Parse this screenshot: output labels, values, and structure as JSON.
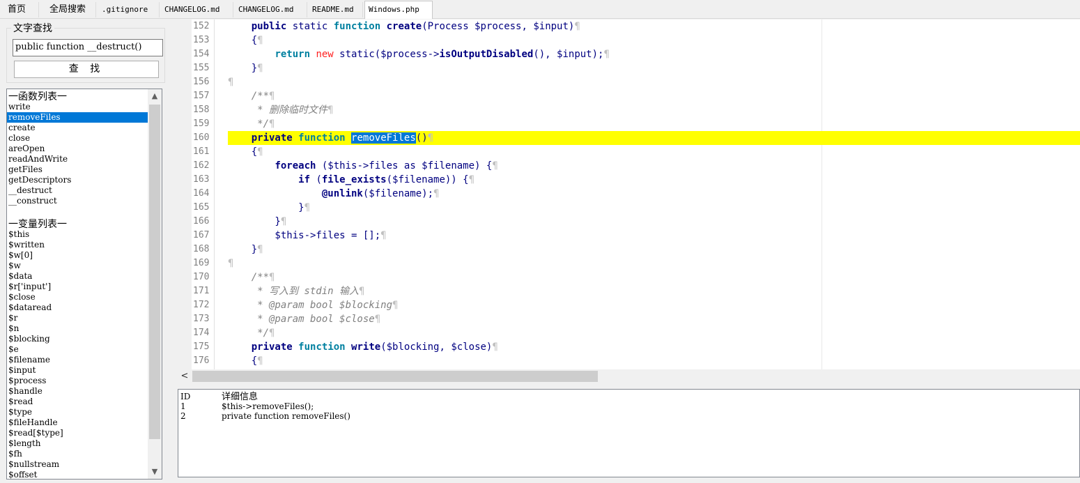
{
  "tabs": [
    "首页",
    "全局搜索",
    ".gitignore",
    "CHANGELOG.md",
    "CHANGELOG.md",
    "README.md",
    "Windows.php"
  ],
  "search": {
    "legend": "文字查找",
    "value": "public function __destruct()",
    "button_label": "查 找"
  },
  "symbols": {
    "functions_header": "一函数列表一",
    "functions": [
      "write",
      "removeFiles",
      "create",
      "close",
      "areOpen",
      "readAndWrite",
      "getFiles",
      "getDescriptors",
      "__destruct",
      "__construct"
    ],
    "selected_function": "removeFiles",
    "variables_header": "一变量列表一",
    "variables": [
      "$this",
      "$written",
      "$w[0]",
      "$w",
      "$data",
      "$r['input']",
      "$close",
      "$dataread",
      "$r",
      "$n",
      "$blocking",
      "$e",
      "$filename",
      "$input",
      "$process",
      "$handle",
      "$read",
      "$type",
      "$fileHandle",
      "$read[$type]",
      "$length",
      "$fh",
      "$nullstream",
      "$offset"
    ]
  },
  "editor": {
    "line_numbers": [
      "152",
      "153",
      "154",
      "155",
      "156",
      "157",
      "158",
      "159",
      "160",
      "161",
      "162",
      "163",
      "164",
      "165",
      "166",
      "167",
      "168",
      "169",
      "170",
      "171",
      "172",
      "173",
      "174",
      "175",
      "176"
    ],
    "highlighted_line": "160",
    "selected_word": "removeFiles",
    "code": {
      "l152": [
        "    ",
        "public",
        " static ",
        "function",
        " ",
        "create",
        "(Process $process, $input)"
      ],
      "l153": "    {",
      "l154": [
        "        ",
        "return",
        " ",
        "new",
        " static($process->",
        "isOutputDisabled",
        "(), $input);"
      ],
      "l155": "    }",
      "l156": "",
      "l157": "    /**",
      "l158": "     * 删除临时文件",
      "l159": "     */",
      "l160": [
        "    ",
        "private",
        " ",
        "function",
        " ",
        "removeFiles",
        "()"
      ],
      "l161": "    {",
      "l162": [
        "        ",
        "foreach",
        " ($this->files as $filename) {"
      ],
      "l163": [
        "            ",
        "if",
        " (",
        "file_exists",
        "($filename)) {"
      ],
      "l164": [
        "                ",
        "@unlink",
        "($filename);"
      ],
      "l165": "            }",
      "l166": "        }",
      "l167": "        $this->files = [];",
      "l168": "    }",
      "l169": "",
      "l170": "    /**",
      "l171": "     * 写入到 stdin 输入",
      "l172": "     * @param bool $blocking",
      "l173": "     * @param bool $close",
      "l174": "     */",
      "l175": [
        "    ",
        "private",
        " ",
        "function",
        " ",
        "write",
        "($blocking, $close)"
      ],
      "l176": "    {"
    },
    "pilcrow": "¶"
  },
  "scroll": {
    "left_arrow": "<",
    "up_arrow": "▲",
    "down_arrow": "▼"
  },
  "results": {
    "header_id": "ID",
    "header_detail": "详细信息",
    "rows": [
      {
        "id": "1",
        "detail": "$this->removeFiles();"
      },
      {
        "id": "2",
        "detail": "private function removeFiles()"
      }
    ]
  },
  "colors": {
    "highlight": "#ffff00",
    "selection": "#0078d7",
    "keyword": "#000080",
    "comment": "#808080",
    "new_keyword": "#ff2020"
  }
}
